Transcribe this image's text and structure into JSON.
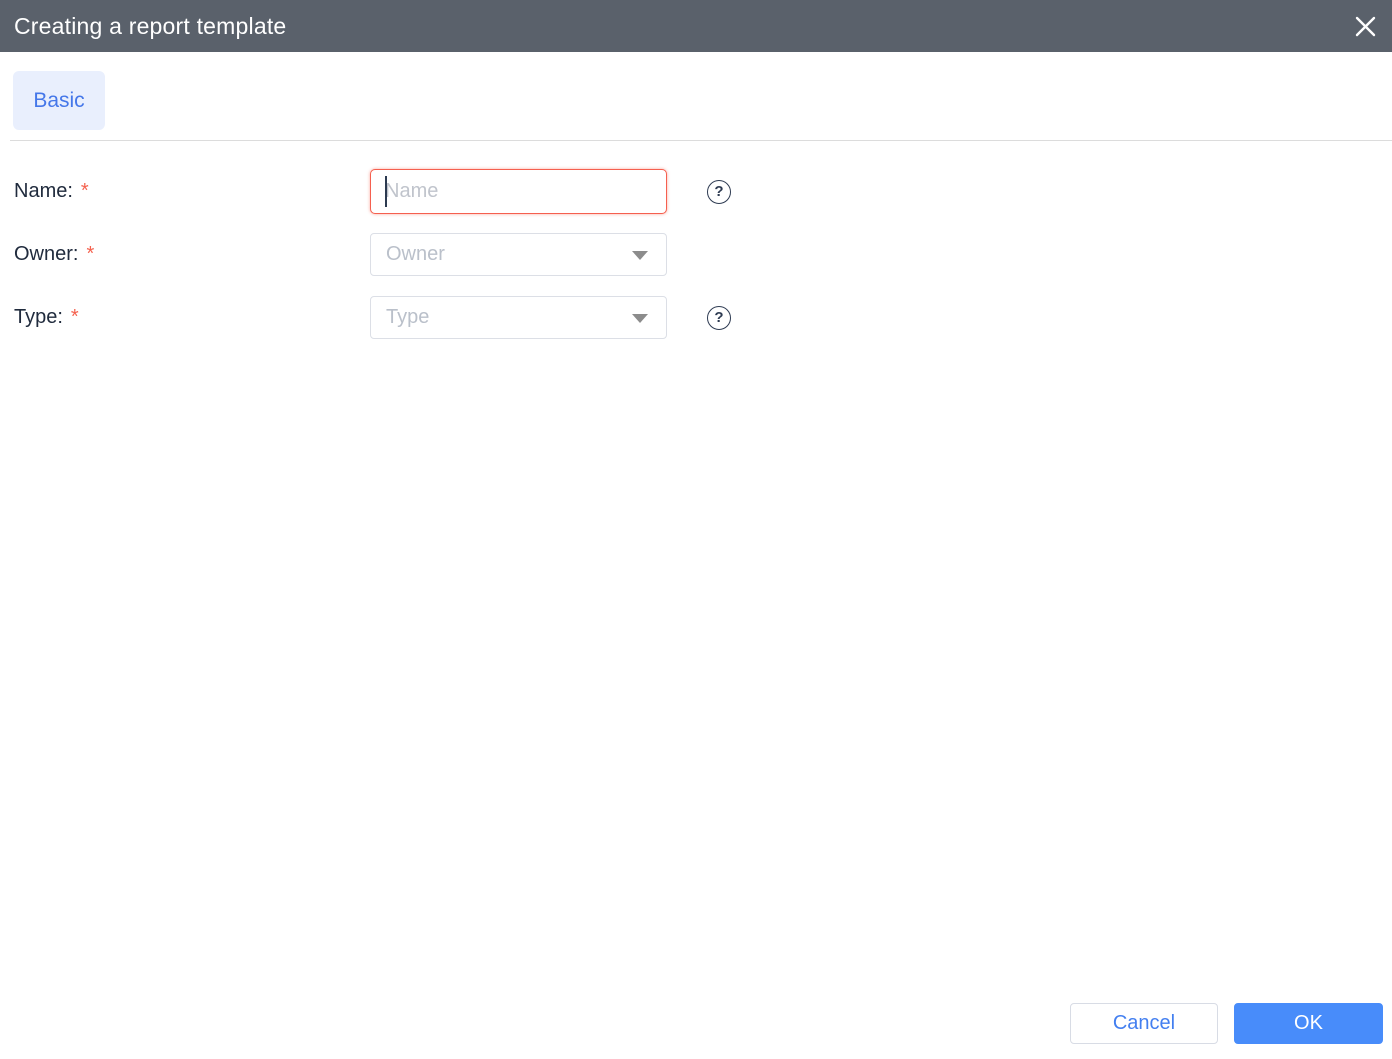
{
  "header": {
    "title": "Creating a report template"
  },
  "tabs": [
    {
      "label": "Basic",
      "active": true
    }
  ],
  "form": {
    "required_marker": "*",
    "fields": [
      {
        "label": "Name:",
        "placeholder": "Name",
        "type": "text",
        "has_help": true
      },
      {
        "label": "Owner:",
        "placeholder": "Owner",
        "type": "select",
        "has_help": false
      },
      {
        "label": "Type:",
        "placeholder": "Type",
        "type": "select",
        "has_help": true
      }
    ]
  },
  "footer": {
    "cancel_label": "Cancel",
    "ok_label": "OK"
  },
  "icons": {
    "close": "close-icon",
    "help_glyph": "?",
    "dropdown": "chevron-down-icon"
  },
  "colors": {
    "header_bg": "#5a616b",
    "tab_bg": "#e9effd",
    "tab_text": "#4577e9",
    "label_text": "#202b3d",
    "asterisk": "#f5614e",
    "error_border": "#f5604f",
    "placeholder": "#c0c4cc",
    "select_border": "#dcdfe6",
    "primary_button_bg": "#488cfa",
    "cancel_text": "#437ff0",
    "divider": "#dcdcdc"
  }
}
